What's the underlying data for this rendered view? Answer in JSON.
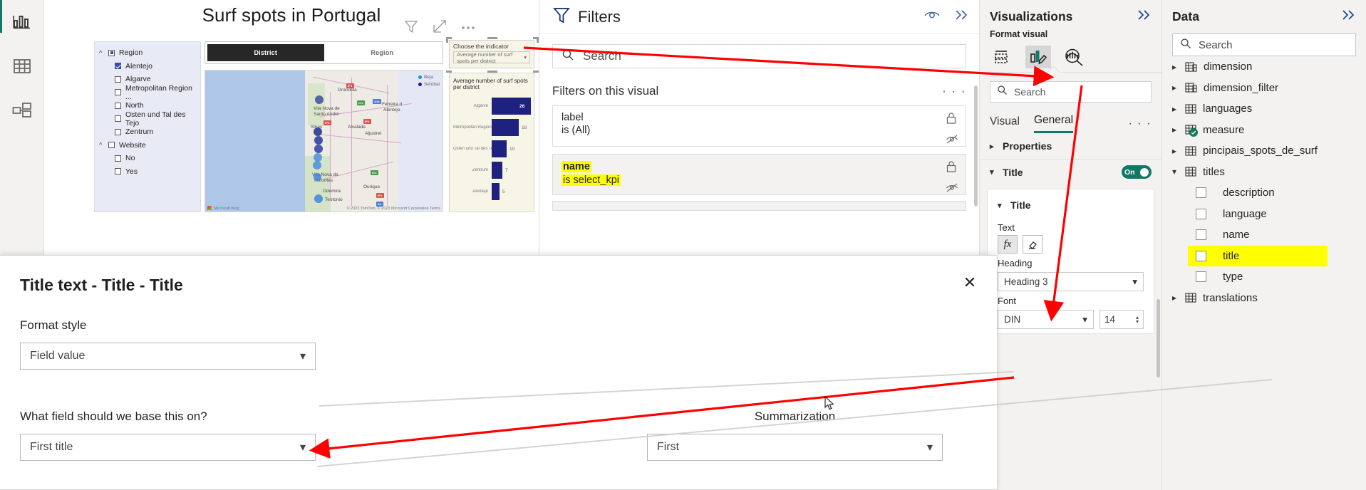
{
  "nav_rail": {
    "items": [
      {
        "name": "report-view",
        "icon": "bar-chart-icon"
      },
      {
        "name": "table-view",
        "icon": "table-icon"
      },
      {
        "name": "model-view",
        "icon": "model-icon"
      }
    ]
  },
  "canvas": {
    "report_title": "Surf spots in Portugal",
    "toolbar": [
      {
        "label": "Filters",
        "icon": "funnel-icon"
      },
      {
        "label": "Focus mode",
        "icon": "focus-mode-icon"
      },
      {
        "label": "More options",
        "icon": "more-options-icon"
      }
    ],
    "slicer": {
      "groups": [
        {
          "label": "Region",
          "state": "partial",
          "items": [
            {
              "label": "Alentejo",
              "checked": true
            },
            {
              "label": "Algarve",
              "checked": false
            },
            {
              "label": "Metropolitan Region ...",
              "checked": false
            },
            {
              "label": "North",
              "checked": false
            },
            {
              "label": "Osten und Tal des Tejo",
              "checked": false
            },
            {
              "label": "Zentrum",
              "checked": false
            }
          ]
        },
        {
          "label": "Website",
          "state": "unchecked",
          "items": [
            {
              "label": "No",
              "checked": false
            },
            {
              "label": "Yes",
              "checked": false
            }
          ]
        }
      ]
    },
    "toggle_slicer": {
      "selected": "District",
      "other": "Region"
    },
    "map": {
      "legend": [
        {
          "label": "Beja",
          "color": "#2e8bd9"
        },
        {
          "label": "Setúbal",
          "color": "#1a1a8c"
        }
      ],
      "towns": [
        "Grandola",
        "Vila Nova de",
        "Santo André",
        "Sines",
        "Alvalade",
        "Ferreira d",
        "Alentejo",
        "Aljustrel",
        "Vila Nova de",
        "Milfontes",
        "Odemira",
        "Ourique",
        "Teotonio"
      ],
      "credit_left": "Microsoft Bing",
      "credit_right": "© 2023 TomTom, © 2023 Microsoft Corporation   Terms"
    },
    "dropdown_slicer": {
      "label": "Choose the indicator",
      "value": "Average number of surf spots per district"
    }
  },
  "chart_data": {
    "type": "bar",
    "title": "Average number of surf spots per district",
    "categories": [
      "Algarve",
      "Metropolitan Region of Lis...",
      "Osten und Tal des Tejo",
      "Zentrum",
      "Alentejo"
    ],
    "values": [
      26,
      18,
      10,
      7,
      5
    ],
    "xlabel": "",
    "ylabel": "",
    "ylim": [
      0,
      26
    ],
    "orientation": "horizontal",
    "bar_color": "#1f2180",
    "background": "#f7f5e6",
    "grid": false,
    "legend": "none"
  },
  "filters_pane": {
    "title": "Filters",
    "funnel_icon": "funnel-icon",
    "eye_icon": "eye-icon",
    "collapse_icon": "chevron-double-right-icon",
    "search_placeholder": "Search",
    "section_title": "Filters on this visual",
    "more_label": "· · ·",
    "cards": [
      {
        "field": "label",
        "condition": "is (All)",
        "highlighted": false,
        "active": false
      },
      {
        "field": "name",
        "condition": "is select_kpi",
        "highlighted": true,
        "active": true
      }
    ]
  },
  "viz_pane": {
    "title": "Visualizations",
    "collapse_icon": "chevron-double-right-icon",
    "subtitle": "Format visual",
    "icons": [
      {
        "name": "build-visual-icon",
        "selected": false
      },
      {
        "name": "format-visual-paintbrush-icon",
        "selected": true
      },
      {
        "name": "analytics-magnifier-icon",
        "selected": false
      }
    ],
    "search_placeholder": "Search",
    "tabs": [
      {
        "label": "Visual",
        "active": false
      },
      {
        "label": "General",
        "active": true
      }
    ],
    "more_label": "· · ·",
    "sections": [
      {
        "label": "Properties",
        "expanded": false
      },
      {
        "label": "Title",
        "expanded": true,
        "toggle": "On"
      },
      {
        "label": "Title",
        "expanded": true
      }
    ],
    "text_label": "Text",
    "fx_button": "fx",
    "erase_button": "eraser-icon",
    "heading_label": "Heading",
    "heading_value": "Heading 3",
    "font_label": "Font",
    "font_family": "DIN",
    "font_size": "14"
  },
  "data_pane": {
    "title": "Data",
    "collapse_icon": "chevron-double-right-icon",
    "search_placeholder": "Search",
    "tables": [
      {
        "label": "dimension",
        "expanded": false,
        "icon": "linked-table-icon"
      },
      {
        "label": "dimension_filter",
        "expanded": false,
        "icon": "linked-table-icon"
      },
      {
        "label": "languages",
        "expanded": false,
        "icon": "table-icon"
      },
      {
        "label": "measure",
        "expanded": false,
        "icon": "table-icon",
        "badge": "measure-check-badge"
      },
      {
        "label": "pincipais_spots_de_surf",
        "expanded": false,
        "icon": "table-icon"
      },
      {
        "label": "titles",
        "expanded": true,
        "icon": "table-icon"
      }
    ],
    "title_fields": [
      {
        "label": "description",
        "checked": false,
        "highlighted": false
      },
      {
        "label": "language",
        "checked": false,
        "highlighted": false
      },
      {
        "label": "name",
        "checked": false,
        "highlighted": false
      },
      {
        "label": "title",
        "checked": false,
        "highlighted": true
      },
      {
        "label": "type",
        "checked": false,
        "highlighted": false
      }
    ],
    "trailing_tables": [
      {
        "label": "translations",
        "expanded": false,
        "icon": "table-icon"
      }
    ]
  },
  "modal": {
    "title": "Title text - Title - Title",
    "close_icon": "close-icon",
    "format_style_label": "Format style",
    "format_style_value": "Field value",
    "field_label": "What field should we base this on?",
    "field_value": "First title",
    "summarization_label": "Summarization",
    "summarization_value": "First"
  },
  "colors": {
    "accent": "#117865",
    "highlight": "#ffff00",
    "annotation": "#ff0000",
    "bar": "#1f2180"
  }
}
